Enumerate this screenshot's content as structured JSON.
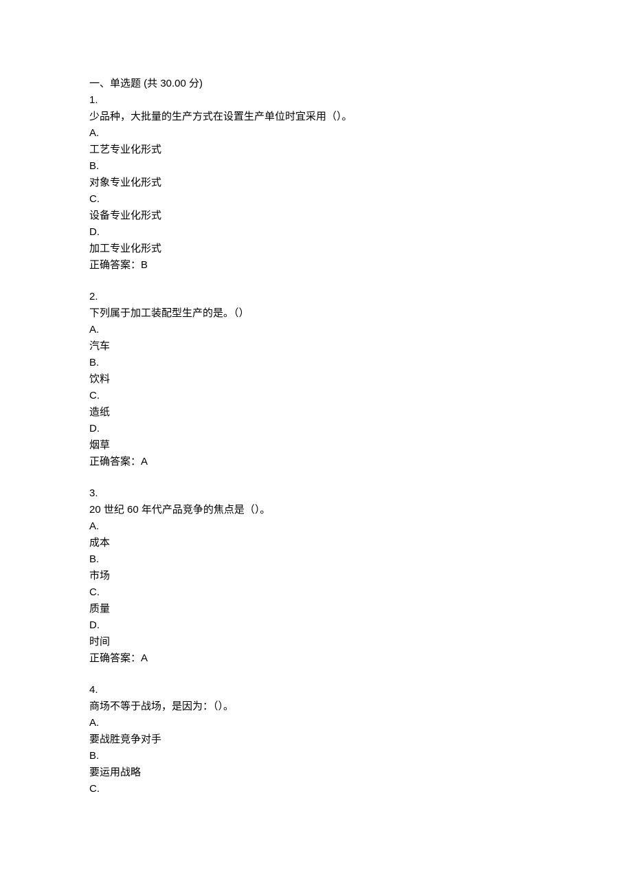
{
  "section": {
    "title": "一、单选题 (共 30.00 分)"
  },
  "questions": [
    {
      "number": "1.",
      "stem": "少品种，大批量的生产方式在设置生产单位时宜采用（）。",
      "options": [
        {
          "letter": "A.",
          "text": "工艺专业化形式"
        },
        {
          "letter": "B.",
          "text": "对象专业化形式"
        },
        {
          "letter": "C.",
          "text": "设备专业化形式"
        },
        {
          "letter": "D.",
          "text": "加工专业化形式"
        }
      ],
      "answer_label": "正确答案：",
      "answer": "B"
    },
    {
      "number": "2.",
      "stem": "下列属于加工装配型生产的是。（）",
      "options": [
        {
          "letter": "A.",
          "text": "汽车"
        },
        {
          "letter": "B.",
          "text": "饮料"
        },
        {
          "letter": "C.",
          "text": "造纸"
        },
        {
          "letter": "D.",
          "text": "烟草"
        }
      ],
      "answer_label": "正确答案：",
      "answer": "A"
    },
    {
      "number": "3.",
      "stem": "20 世纪 60 年代产品竞争的焦点是（）。",
      "options": [
        {
          "letter": "A.",
          "text": "成本"
        },
        {
          "letter": "B.",
          "text": "市场"
        },
        {
          "letter": "C.",
          "text": "质量"
        },
        {
          "letter": "D.",
          "text": "时间"
        }
      ],
      "answer_label": "正确答案：",
      "answer": "A"
    },
    {
      "number": "4.",
      "stem": "商场不等于战场，是因为：（）。",
      "options": [
        {
          "letter": "A.",
          "text": "要战胜竞争对手"
        },
        {
          "letter": "B.",
          "text": "要运用战略"
        },
        {
          "letter": "C.",
          "text": ""
        }
      ],
      "answer_label": "",
      "answer": ""
    }
  ]
}
